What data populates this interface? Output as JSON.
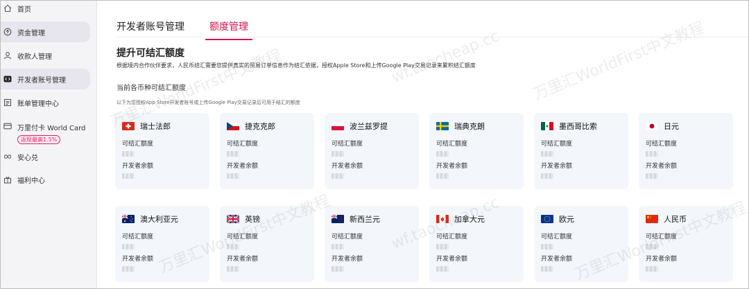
{
  "sidebar": {
    "items": [
      {
        "label": "首页",
        "icon": "home-icon"
      },
      {
        "label": "资金管理",
        "icon": "funds-icon",
        "active": true
      },
      {
        "label": "收款人管理",
        "icon": "user-icon"
      },
      {
        "label": "开发者账号管理",
        "icon": "code-icon",
        "active": true
      },
      {
        "label": "账单管理中心",
        "icon": "bill-icon"
      },
      {
        "label": "万里付卡 World Card",
        "icon": "card-icon",
        "badge": "返现最高1.5%"
      },
      {
        "label": "安心兑",
        "icon": "exchange-icon"
      },
      {
        "label": "福利中心",
        "icon": "gift-icon"
      }
    ]
  },
  "tabs": [
    {
      "label": "开发者账号管理"
    },
    {
      "label": "额度管理",
      "active": true
    }
  ],
  "section": {
    "title": "提升可结汇额度",
    "description": "根据境内合作伙伴要求，人民币结汇需要您提供真实的贸易订单信息作为结汇依据，授权Apple Store和上传Google Play交易记录来累积结汇额度",
    "subtitle": "当前各币种可结汇额度",
    "subdescription": "以下为您授权App Store开发者账号或上传Google Play交易记录后可用于结汇的额度"
  },
  "card_labels": {
    "quota": "可结汇额度",
    "balance": "开发者余额"
  },
  "currencies": [
    {
      "name": "瑞士法郎",
      "flag": "switzerland"
    },
    {
      "name": "捷克克郎",
      "flag": "czech"
    },
    {
      "name": "波兰兹罗提",
      "flag": "poland"
    },
    {
      "name": "瑞典克朗",
      "flag": "sweden"
    },
    {
      "name": "墨西哥比索",
      "flag": "mexico"
    },
    {
      "name": "日元",
      "flag": "japan"
    },
    {
      "name": "澳大利亚元",
      "flag": "australia"
    },
    {
      "name": "英镑",
      "flag": "uk"
    },
    {
      "name": "新西兰元",
      "flag": "newzealand"
    },
    {
      "name": "加拿大元",
      "flag": "canada"
    },
    {
      "name": "欧元",
      "flag": "eu"
    },
    {
      "name": "人民币",
      "flag": "china"
    }
  ],
  "watermark": "万里汇WorldFirst中文教程 wf.taocheap.cc",
  "colors": {
    "accent": "#d8144d",
    "card_bg": "#f3f6fb",
    "sidebar_bg": "#f4f4f6"
  }
}
